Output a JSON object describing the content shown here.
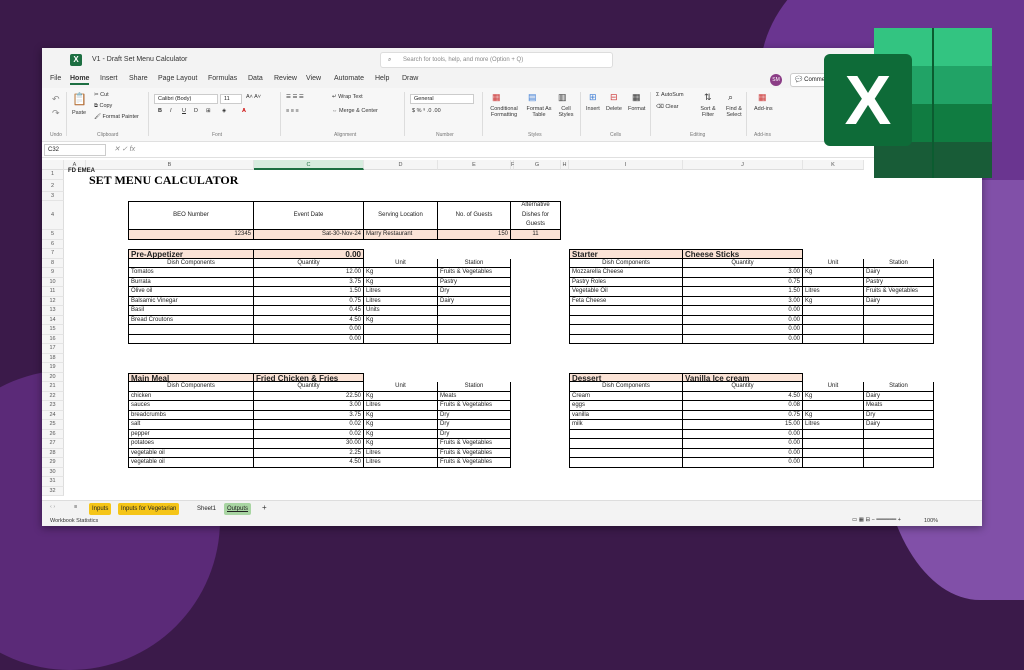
{
  "window": {
    "title": "V1 - Draft Set Menu Calculator",
    "search_placeholder": "Search for tools, help, and more (Option + Q)",
    "avatar": "SM",
    "comments": "Comme"
  },
  "menu": [
    "File",
    "Home",
    "Insert",
    "Share",
    "Page Layout",
    "Formulas",
    "Data",
    "Review",
    "View",
    "Automate",
    "Help",
    "Draw"
  ],
  "ribbon": {
    "undo": "Undo",
    "paste": "Paste",
    "cut": "Cut",
    "copy": "Copy",
    "format_painter": "Format Painter",
    "clipboard": "Clipboard",
    "font_name": "Calibri (Body)",
    "font_size": "11",
    "font": "Font",
    "wrap": "Wrap Text",
    "merge": "Merge & Center",
    "alignment": "Alignment",
    "number_format": "General",
    "number": "Number",
    "conditional": "Conditional Formatting",
    "format_as": "Format As Table",
    "cell_styles": "Cell Styles",
    "styles": "Styles",
    "insert": "Insert",
    "delete": "Delete",
    "format": "Format",
    "cells": "Cells",
    "autosum": "AutoSum",
    "clear": "Clear",
    "sort": "Sort & Filter",
    "find": "Find & Select",
    "editing": "Editing",
    "addins": "Add-ins",
    "addins_group": "Add-ins"
  },
  "formula_bar": {
    "cell_ref": "C32",
    "fx": "fx"
  },
  "columns": [
    "A",
    "B",
    "C",
    "D",
    "E",
    "F",
    "G",
    "H",
    "I",
    "J",
    "K"
  ],
  "sheet": {
    "title": "SET MENU CALCULATOR",
    "logo": "FD EMEA",
    "headers": [
      "BEO Number",
      "Event Date",
      "Serving Location",
      "No. of Guests",
      "Alternative Dishes for Guests"
    ],
    "values": [
      "12345",
      "Sat-30-Nov-24",
      "Marry Restaurant",
      "150",
      "11"
    ],
    "sub_headers": [
      "Dish Components",
      "Quantity",
      "Unit",
      "Station"
    ],
    "preappetizer": {
      "label": "Pre-Appetizer",
      "dish": "0.00",
      "rows": [
        [
          "Tomatos",
          "12.00",
          "Kg",
          "Fruits & Vegetables"
        ],
        [
          "Burrata",
          "3.75",
          "Kg",
          "Pastry"
        ],
        [
          "Olive oil",
          "1.50",
          "Litres",
          "Dry"
        ],
        [
          "Balsamic Vinegar",
          "0.75",
          "Litres",
          "Dairy"
        ],
        [
          "Basil",
          "0.45",
          "Units",
          ""
        ],
        [
          "Bread Croutons",
          "4.50",
          "Kg",
          ""
        ],
        [
          "",
          "0.00",
          "",
          ""
        ],
        [
          "",
          "0.00",
          "",
          ""
        ]
      ]
    },
    "starter": {
      "label": "Starter",
      "dish": "Cheese Sticks",
      "rows": [
        [
          "Mozzarella Cheese",
          "3.00",
          "Kg",
          "Dairy"
        ],
        [
          "Pastry Roles",
          "0.75",
          "",
          "Pastry"
        ],
        [
          "Vegetable Oil",
          "1.50",
          "Litres",
          "Fruits & Vegetables"
        ],
        [
          "Feta Cheese",
          "3.00",
          "Kg",
          "Dairy"
        ],
        [
          "",
          "0.00",
          "",
          ""
        ],
        [
          "",
          "0.00",
          "",
          ""
        ],
        [
          "",
          "0.00",
          "",
          ""
        ],
        [
          "",
          "0.00",
          "",
          ""
        ]
      ]
    },
    "main": {
      "label": "Main Meal",
      "dish": "Fried Chicken & Fries",
      "rows": [
        [
          "chicken",
          "22.50",
          "Kg",
          "Meats"
        ],
        [
          "sauces",
          "3.00",
          "Litres",
          "Fruits & Vegetables"
        ],
        [
          "breadcrumbs",
          "3.75",
          "Kg",
          "Dry"
        ],
        [
          "salt",
          "0.02",
          "Kg",
          "Dry"
        ],
        [
          "pepper",
          "0.02",
          "Kg",
          "Dry"
        ],
        [
          "potatoes",
          "30.00",
          "Kg",
          "Fruits & Vegetables"
        ],
        [
          "vegetable oil",
          "2.25",
          "Litres",
          "Fruits & Vegetables"
        ],
        [
          "vegetable oil",
          "4.50",
          "Litres",
          "Fruits & Vegetables"
        ]
      ]
    },
    "dessert": {
      "label": "Dessert",
      "dish": "Vanilla Ice cream",
      "rows": [
        [
          "Cream",
          "4.50",
          "Kg",
          "Dairy"
        ],
        [
          "eggs",
          "0.08",
          "",
          "Meats"
        ],
        [
          "vanilla",
          "0.75",
          "Kg",
          "Dry"
        ],
        [
          "milk",
          "15.00",
          "Litres",
          "Dairy"
        ],
        [
          "",
          "0.00",
          "",
          ""
        ],
        [
          "",
          "0.00",
          "",
          ""
        ],
        [
          "",
          "0.00",
          "",
          ""
        ],
        [
          "",
          "0.00",
          "",
          ""
        ]
      ]
    }
  },
  "tabs": [
    "Inputs",
    "Inputs for Vegetarian",
    "Sheet1",
    "Outputs"
  ],
  "status": {
    "left": "Workbook Statistics",
    "zoom": "100%"
  }
}
